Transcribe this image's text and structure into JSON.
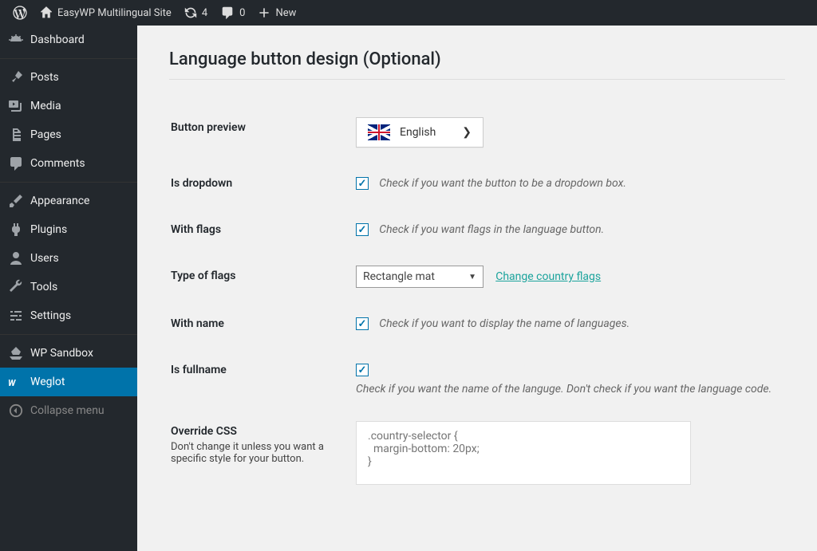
{
  "adminbar": {
    "site_name": "EasyWP Multilingual Site",
    "updates_count": "4",
    "comments_count": "0",
    "new_label": "New"
  },
  "sidebar": {
    "items": [
      {
        "id": "dashboard",
        "label": "Dashboard",
        "icon": "dashboard-icon"
      },
      {
        "id": "posts",
        "label": "Posts",
        "icon": "pin-icon"
      },
      {
        "id": "media",
        "label": "Media",
        "icon": "media-icon"
      },
      {
        "id": "pages",
        "label": "Pages",
        "icon": "page-icon"
      },
      {
        "id": "comments",
        "label": "Comments",
        "icon": "comment-icon"
      },
      {
        "id": "appearance",
        "label": "Appearance",
        "icon": "brush-icon"
      },
      {
        "id": "plugins",
        "label": "Plugins",
        "icon": "plug-icon"
      },
      {
        "id": "users",
        "label": "Users",
        "icon": "user-icon"
      },
      {
        "id": "tools",
        "label": "Tools",
        "icon": "wrench-icon"
      },
      {
        "id": "settings",
        "label": "Settings",
        "icon": "sliders-icon"
      },
      {
        "id": "wp-sandbox",
        "label": "WP Sandbox",
        "icon": "sandbox-icon"
      },
      {
        "id": "weglot",
        "label": "Weglot",
        "icon": "weglot-icon"
      }
    ],
    "collapse_label": "Collapse menu"
  },
  "page": {
    "heading": "Language button design (Optional)",
    "fields": {
      "button_preview": {
        "label": "Button preview",
        "language": "English"
      },
      "is_dropdown": {
        "label": "Is dropdown",
        "desc": "Check if you want the button to be a dropdown box.",
        "checked": true
      },
      "with_flags": {
        "label": "With flags",
        "desc": "Check if you want flags in the language button.",
        "checked": true
      },
      "type_of_flags": {
        "label": "Type of flags",
        "value": "Rectangle mat",
        "change_link": "Change country flags"
      },
      "with_name": {
        "label": "With name",
        "desc": "Check if you want to display the name of languages.",
        "checked": true
      },
      "is_fullname": {
        "label": "Is fullname",
        "desc": "Check if you want the name of the languge. Don't check if you want the language code.",
        "checked": true
      },
      "override_css": {
        "label": "Override CSS",
        "note": "Don't change it unless you want a specific style for your button.",
        "placeholder": ".country-selector {\n  margin-bottom: 20px;\n}"
      }
    }
  }
}
